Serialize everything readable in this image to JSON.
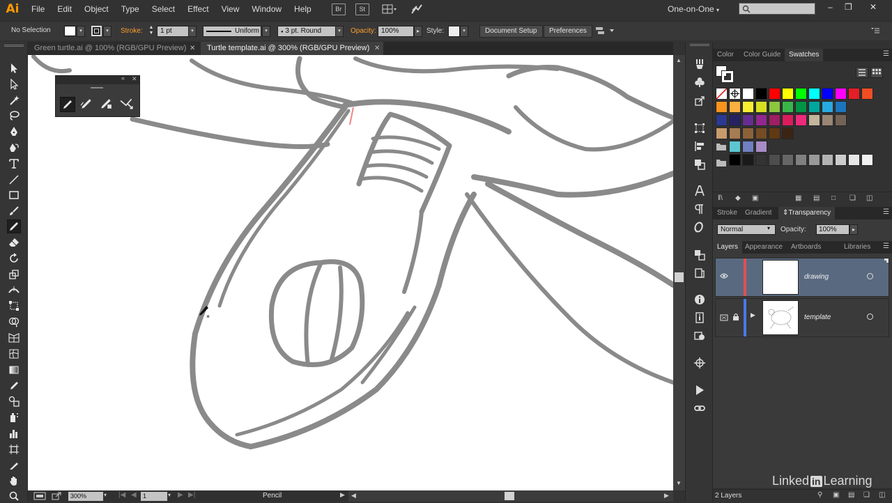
{
  "app": {
    "logo": "Ai",
    "menus": [
      "File",
      "Edit",
      "Object",
      "Type",
      "Select",
      "Effect",
      "View",
      "Window",
      "Help"
    ],
    "bridge_label": "Br",
    "stock_label": "St",
    "workspace": "One-on-One",
    "window_controls": [
      "–",
      "❒",
      "✕"
    ]
  },
  "control": {
    "selection": "No Selection",
    "stroke_label": "Stroke:",
    "stroke_weight": "1 pt",
    "profile": "Uniform",
    "brush": "3 pt. Round",
    "opacity_label": "Opacity:",
    "opacity": "100%",
    "style_label": "Style:",
    "document_setup": "Document Setup",
    "preferences": "Preferences"
  },
  "tabs": [
    {
      "label": "Green turtle.ai @ 100% (RGB/GPU Preview)",
      "active": false
    },
    {
      "label": "Turtle template.ai @ 300% (RGB/GPU Preview)",
      "active": true
    }
  ],
  "status": {
    "zoom": "300%",
    "artboard": "1",
    "tool": "Pencil"
  },
  "panels": {
    "color_tabs": [
      "Color",
      "Color Guide",
      "Swatches"
    ],
    "active_color_tab": "Swatches",
    "stroke_tabs": [
      "Stroke",
      "Gradient",
      "Transparency"
    ],
    "blend_mode": "Normal",
    "transparency_opacity_label": "Opacity:",
    "transparency_opacity": "100%",
    "layers_tabs": [
      "Layers",
      "Appearance",
      "Artboards",
      "Libraries"
    ],
    "layers": [
      {
        "name": "drawing",
        "color": "#e05050",
        "visible": true,
        "locked": false,
        "selected": true
      },
      {
        "name": "template",
        "color": "#4a78e8",
        "visible": true,
        "locked": true,
        "selected": false
      }
    ],
    "layer_count": "2 Layers"
  },
  "swatches": [
    [
      "#ffffff",
      "#000000",
      "#ff0000",
      "#ffff00",
      "#00ff00",
      "#00ffff",
      "#0000ff",
      "#ff00ff",
      "#e41e26",
      "#f04d23"
    ],
    [
      "#f7941d",
      "#fbb040",
      "#f9ed32",
      "#d7df23",
      "#8dc63f",
      "#39b54a",
      "#009444",
      "#00a79d",
      "#27aae1",
      "#1c75bc"
    ],
    [
      "#2b3990",
      "#262262",
      "#662d91",
      "#92278f",
      "#9e1f63",
      "#da1c5c",
      "#ee2a7b",
      "#c2b59b",
      "#998675",
      "#736357"
    ],
    [
      "#c69c6d",
      "#a67c52",
      "#8c6239",
      "#754c24",
      "#603913",
      "#3c2415"
    ],
    [
      "#5cc6d0",
      "#6f7fc0",
      "#a98bc5"
    ],
    [
      "#000000",
      "#1a1a1a",
      "#333333",
      "#4d4d4d",
      "#666666",
      "#808080",
      "#999999",
      "#b3b3b3",
      "#cccccc",
      "#e6e6e6",
      "#f2f2f2"
    ]
  ],
  "brand": {
    "linkedin_left": "Linked",
    "linkedin_in": "in",
    "linkedin_right": "Learning"
  }
}
